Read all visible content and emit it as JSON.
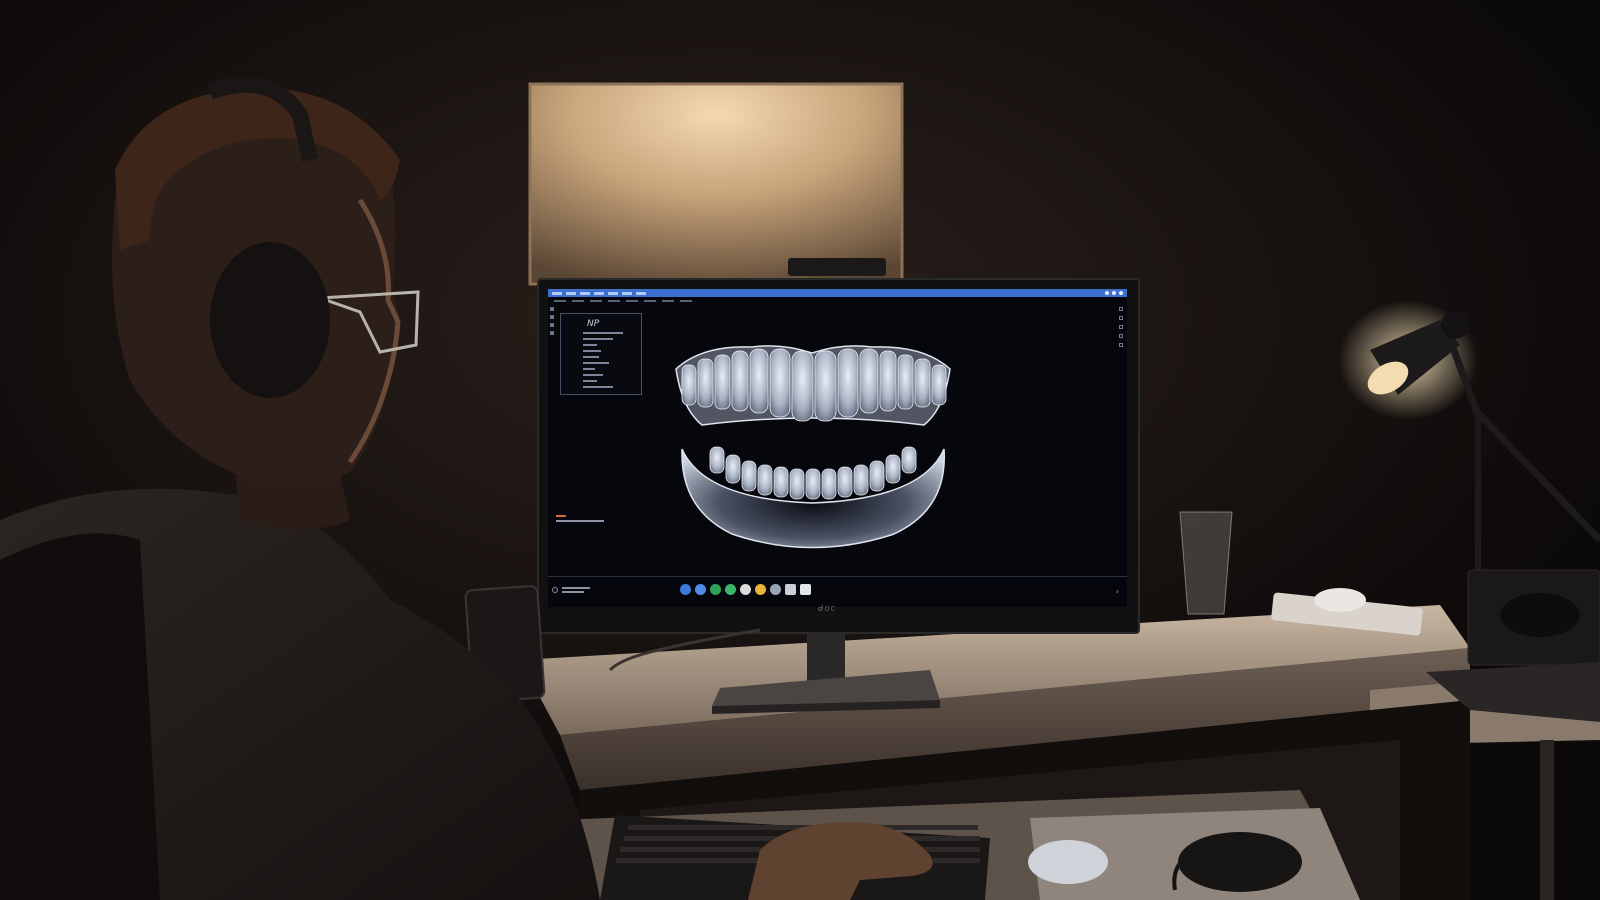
{
  "monitor": {
    "brand": "ᑯoc"
  },
  "app": {
    "accent_color": "#3d6fd0",
    "panel_logo": "NP"
  },
  "dock_icons": [
    {
      "name": "app-icon-blue",
      "color": "#3a7be0"
    },
    {
      "name": "app-icon-blue-2",
      "color": "#4f8ce8"
    },
    {
      "name": "app-icon-green",
      "color": "#2fa35a"
    },
    {
      "name": "app-icon-green-2",
      "color": "#3bb56c"
    },
    {
      "name": "app-icon-white",
      "color": "#dcdcdc"
    },
    {
      "name": "app-icon-chrome",
      "color": "#e7b33b"
    },
    {
      "name": "app-icon-settings",
      "color": "#9aa4b8"
    },
    {
      "name": "app-icon-calendar",
      "color": "#c9ced8"
    },
    {
      "name": "app-icon-document",
      "color": "#e2e5ea"
    }
  ]
}
